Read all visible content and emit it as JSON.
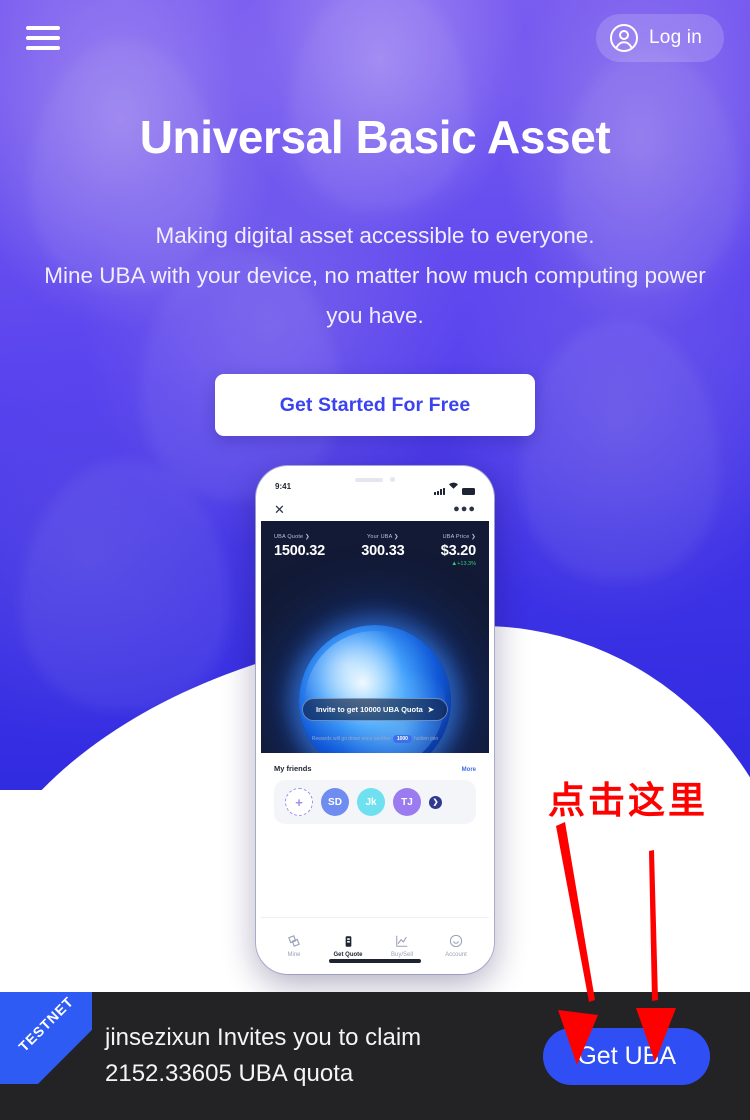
{
  "header": {
    "menu_icon": "hamburger-menu-icon",
    "login_label": "Log in",
    "login_icon": "user-circle-icon"
  },
  "hero": {
    "title": "Universal Basic Asset",
    "subtitle_line1": "Making digital asset accessible to everyone.",
    "subtitle_line2": "Mine UBA with your device, no matter how much computing power",
    "subtitle_line3": "you have.",
    "cta_label": "Get Started For Free",
    "bg_gradient_from": "#7c5ef0",
    "bg_gradient_to": "#2f2ae0",
    "cta_text_color": "#3b43f0"
  },
  "phone": {
    "status": {
      "time": "9:41",
      "signal_icon": "signal-bars-icon",
      "wifi_icon": "wifi-icon",
      "battery_icon": "battery-icon"
    },
    "app_bar": {
      "close_icon": "close-x-icon",
      "more_icon": "more-horizontal-icon"
    },
    "stats": [
      {
        "label": "UBA Quote ❯",
        "value": "1500.32",
        "delta": ""
      },
      {
        "label": "Your UBA ❯",
        "value": "300.33",
        "delta": ""
      },
      {
        "label": "UBA Price ❯",
        "value": "$3.20",
        "delta": "+13.3%",
        "delta_color": "#2fd07a"
      }
    ],
    "invite_pill": {
      "label": "Invite to get 10000 UBA Quota",
      "icon": "share-arrow-icon"
    },
    "reward_note_before": "Rewards will go down once another",
    "reward_note_chip": "1000",
    "reward_note_after": "holden join",
    "friends": {
      "title": "My friends",
      "more_label": "More",
      "avatars": [
        {
          "label": "+",
          "kind": "add",
          "color": "#9b8ff0"
        },
        {
          "label": "SD",
          "kind": "initials",
          "color": "#6f8df0"
        },
        {
          "label": "Jk",
          "kind": "initials",
          "color": "#6fe0f0"
        },
        {
          "label": "TJ",
          "kind": "initials",
          "color": "#9b7cf0"
        },
        {
          "label": "❯",
          "kind": "next",
          "color": "#2f3a8f"
        }
      ]
    },
    "tabs": [
      {
        "label": "Mine",
        "icon": "diamond-icon",
        "active": false
      },
      {
        "label": "Get Quote",
        "icon": "phone-mine-icon",
        "active": true
      },
      {
        "label": "Buy/Sell",
        "icon": "chart-line-icon",
        "active": false
      },
      {
        "label": "Account",
        "icon": "smiley-face-icon",
        "active": false
      }
    ]
  },
  "annotation": {
    "text": "点击这里",
    "color": "#ff0000",
    "arrow_count": 2,
    "arrow_icon": "down-arrow-icon"
  },
  "bottom_bar": {
    "ribbon_label": "TESTNET",
    "ribbon_color": "#2f5bf5",
    "message_line1": "jinsezixun Invites you to claim",
    "message_line2": "2152.33605 UBA quota",
    "button_label": "Get UBA",
    "button_color": "#2f4ff5",
    "bar_color": "#232325"
  }
}
